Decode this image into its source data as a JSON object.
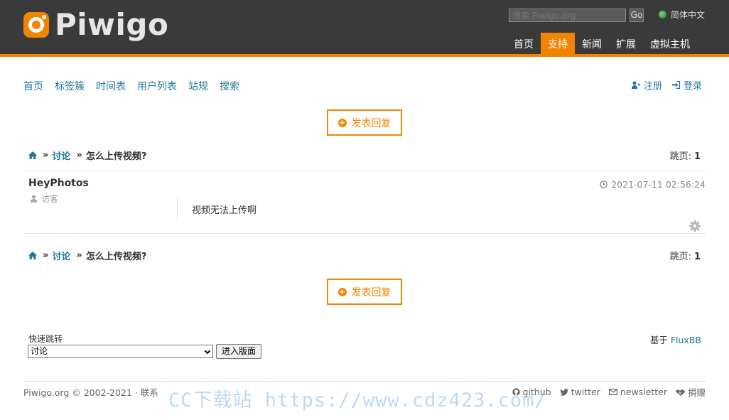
{
  "header": {
    "logo_text": "Piwigo",
    "search_placeholder": "搜索 Piwigo.org",
    "search_go": "Go",
    "language": "简体中文",
    "nav": [
      "首页",
      "支持",
      "新闻",
      "扩展",
      "虚拟主机"
    ],
    "active_nav": "支持",
    "accent_color": "#f28500"
  },
  "subnav": {
    "items": [
      "首页",
      "标签簇",
      "时间表",
      "用户列表",
      "站规",
      "搜索"
    ],
    "register": "注册",
    "login": "登录"
  },
  "reply_label": "发表回复",
  "breadcrumb": {
    "forum": "讨论",
    "topic": "怎么上传视频?",
    "sep": "»"
  },
  "pager": {
    "label": "跳页:",
    "page": "1"
  },
  "post": {
    "author": "HeyPhotos",
    "role": "访客",
    "time": "2021-07-11 02:56:24",
    "body": "视频无法上传啊"
  },
  "quickjump": {
    "label": "快速跳转",
    "selected": "讨论",
    "go": "进入版面"
  },
  "powered": {
    "prefix": "基于",
    "link": "FluxBB"
  },
  "footer": {
    "copyright": "Piwigo.org © 2002-2021 ·",
    "contact": "联系",
    "social": [
      "github",
      "twitter",
      "newsletter",
      "捐赠"
    ]
  },
  "watermark": "CC下载站 https://www.cdz423.com/"
}
